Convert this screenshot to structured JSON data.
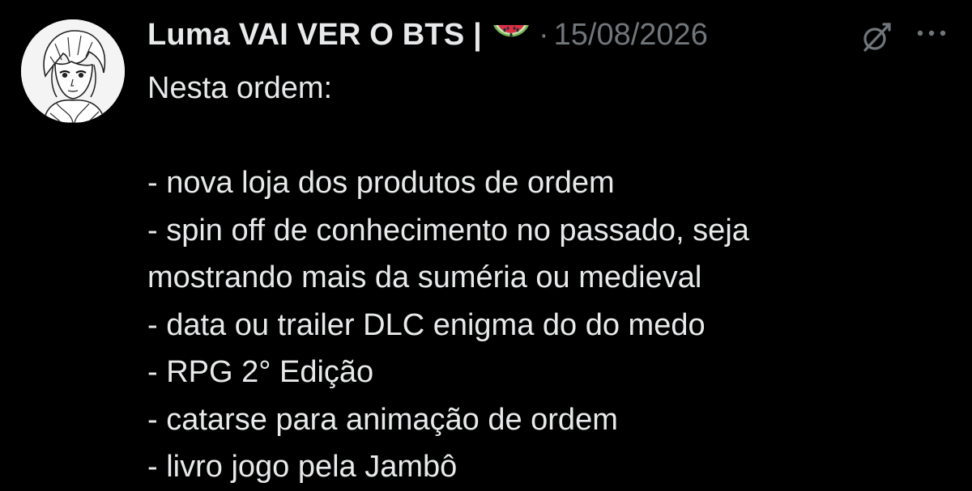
{
  "post": {
    "author": {
      "display_name": "Luma VAI VER O BTS |",
      "name_emoji": "watermelon-emoji",
      "avatar": "manga-portrait-avatar"
    },
    "separator": "·",
    "timestamp": "15/08/2026",
    "actions": {
      "grok_icon": "grok-icon",
      "more_icon": "more-options-icon"
    },
    "text_lines": [
      "Nesta ordem:",
      "",
      "- nova loja dos produtos de ordem",
      "- spin off de conhecimento no passado, seja",
      "mostrando mais da suméria ou medieval",
      "- data ou trailer DLC enigma do do medo",
      "- RPG 2° Edição",
      "- catarse para animação de ordem",
      "- livro jogo pela Jambô"
    ]
  },
  "colors": {
    "background": "#000000",
    "primary_text": "#e7e9ea",
    "secondary_text": "#71767b"
  }
}
